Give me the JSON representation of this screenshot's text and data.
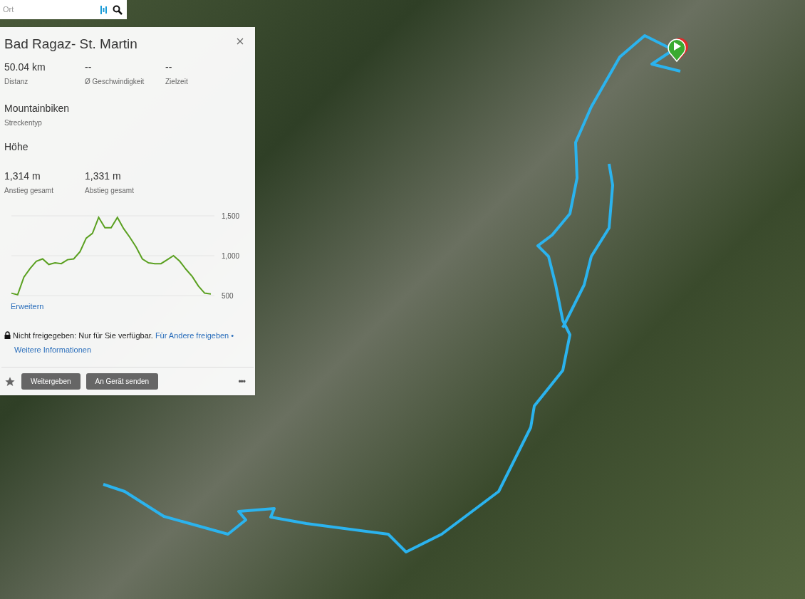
{
  "search": {
    "placeholder": "Ort"
  },
  "route": {
    "title": "Bad Ragaz- St. Martin",
    "stats": [
      {
        "value": "50.04 km",
        "label": "Distanz"
      },
      {
        "value": "--",
        "label": "Ø Geschwindigkeit"
      },
      {
        "value": "--",
        "label": "Zielzeit"
      }
    ],
    "type": {
      "value": "Mountainbiken",
      "label": "Streckentyp"
    },
    "elevation_heading": "Höhe",
    "elevation_stats": [
      {
        "value": "1,314 m",
        "label": "Anstieg gesamt"
      },
      {
        "value": "1,331 m",
        "label": "Abstieg gesamt"
      }
    ],
    "chart_data": {
      "type": "line",
      "yticks": [
        {
          "value": 500,
          "label": "500"
        },
        {
          "value": 1000,
          "label": "1,000"
        },
        {
          "value": 1500,
          "label": "1,500"
        }
      ],
      "ylim": [
        500,
        1500
      ],
      "series": [
        {
          "color": "#5aa020",
          "values": [
            530,
            510,
            730,
            840,
            930,
            960,
            890,
            910,
            900,
            950,
            960,
            1050,
            1220,
            1280,
            1480,
            1350,
            1350,
            1480,
            1340,
            1230,
            1110,
            960,
            910,
            900,
            900,
            950,
            1000,
            930,
            830,
            740,
            620,
            530,
            520
          ]
        }
      ]
    },
    "expand_link": "Erweitern",
    "privacy": {
      "text": "Nicht freigegeben: Nur für Sie verfügbar.",
      "share_link": "Für Andere freigeben",
      "separator": "•",
      "info_link": "Weitere Informationen"
    },
    "favorite": false,
    "buttons": [
      "Weitergeben",
      "An Gerät senden"
    ],
    "more": "•••"
  }
}
